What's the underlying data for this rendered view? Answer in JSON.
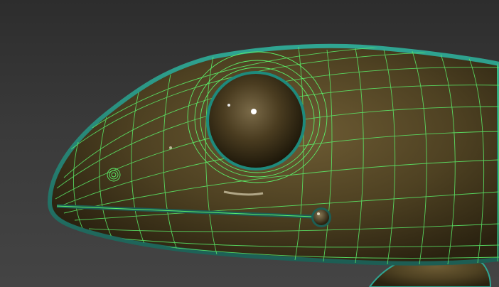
{
  "viewport": {
    "colors": {
      "background_top": "#2d2d2d",
      "background_bottom": "#444444",
      "skin_light": "#6b5a33",
      "skin_dark": "#2a2210",
      "rim_teal": "#2a8f80",
      "wireframe_green": "#5cf06a",
      "eye_highlight": "#ffffff"
    },
    "objects": [
      "gecko-head-mesh",
      "eye",
      "nostril",
      "mouth",
      "mouth-corner-nub",
      "front-leg"
    ],
    "wireframe": true
  }
}
